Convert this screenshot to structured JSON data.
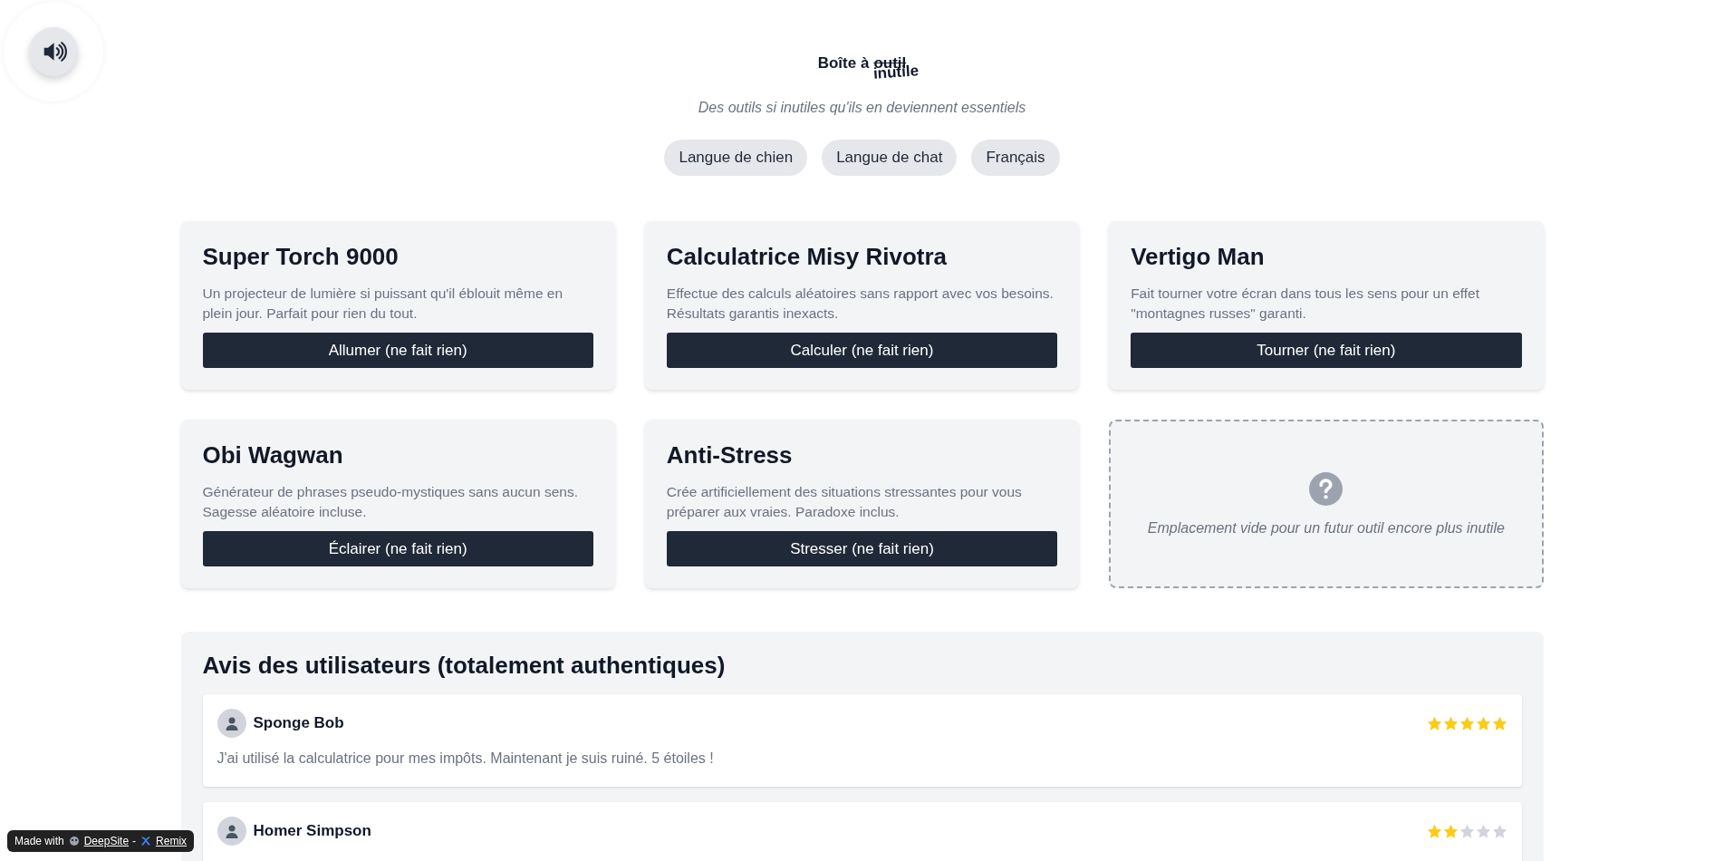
{
  "header": {
    "title_prefix": "Boîte à",
    "title_struck": "outil",
    "title_replacement": "inutile",
    "subtitle": "Des outils si inutiles qu'ils en deviennent essentiels"
  },
  "languages": [
    {
      "label": "Langue de chien"
    },
    {
      "label": "Langue de chat"
    },
    {
      "label": "Français"
    }
  ],
  "tools": [
    {
      "kind": "tool",
      "name": "Super Torch 9000",
      "description": "Un projecteur de lumière si puissant qu'il éblouit même en plein jour. Parfait pour rien du tout.",
      "button": "Allumer (ne fait rien)"
    },
    {
      "kind": "tool",
      "name": "Calculatrice Misy Rivotra",
      "description": "Effectue des calculs aléatoires sans rapport avec vos besoins. Résultats garantis inexacts.",
      "button": "Calculer (ne fait rien)"
    },
    {
      "kind": "tool",
      "name": "Vertigo Man",
      "description": "Fait tourner votre écran dans tous les sens pour un effet \"montagnes russes\" garanti.",
      "button": "Tourner (ne fait rien)"
    },
    {
      "kind": "tool",
      "name": "Obi Wagwan",
      "description": "Générateur de phrases pseudo-mystiques sans aucun sens. Sagesse aléatoire incluse.",
      "button": "Éclairer (ne fait rien)"
    },
    {
      "kind": "tool",
      "name": "Anti-Stress",
      "description": "Crée artificiellement des situations stressantes pour vous préparer aux vraies. Paradoxe inclus.",
      "button": "Stresser (ne fait rien)"
    },
    {
      "kind": "placeholder",
      "description": "Emplacement vide pour un futur outil encore plus inutile"
    }
  ],
  "reviews_section": {
    "title": "Avis des utilisateurs (totalement authentiques)",
    "reviews": [
      {
        "author": "Sponge Bob",
        "stars": 5,
        "text": "J'ai utilisé la calculatrice pour mes impôts. Maintenant je suis ruiné. 5 étoiles !"
      },
      {
        "author": "Homer Simpson",
        "stars": 2
      }
    ]
  },
  "badge": {
    "prefix": "Made with",
    "link": "DeepSite",
    "separator": "-",
    "remix": "Remix"
  }
}
